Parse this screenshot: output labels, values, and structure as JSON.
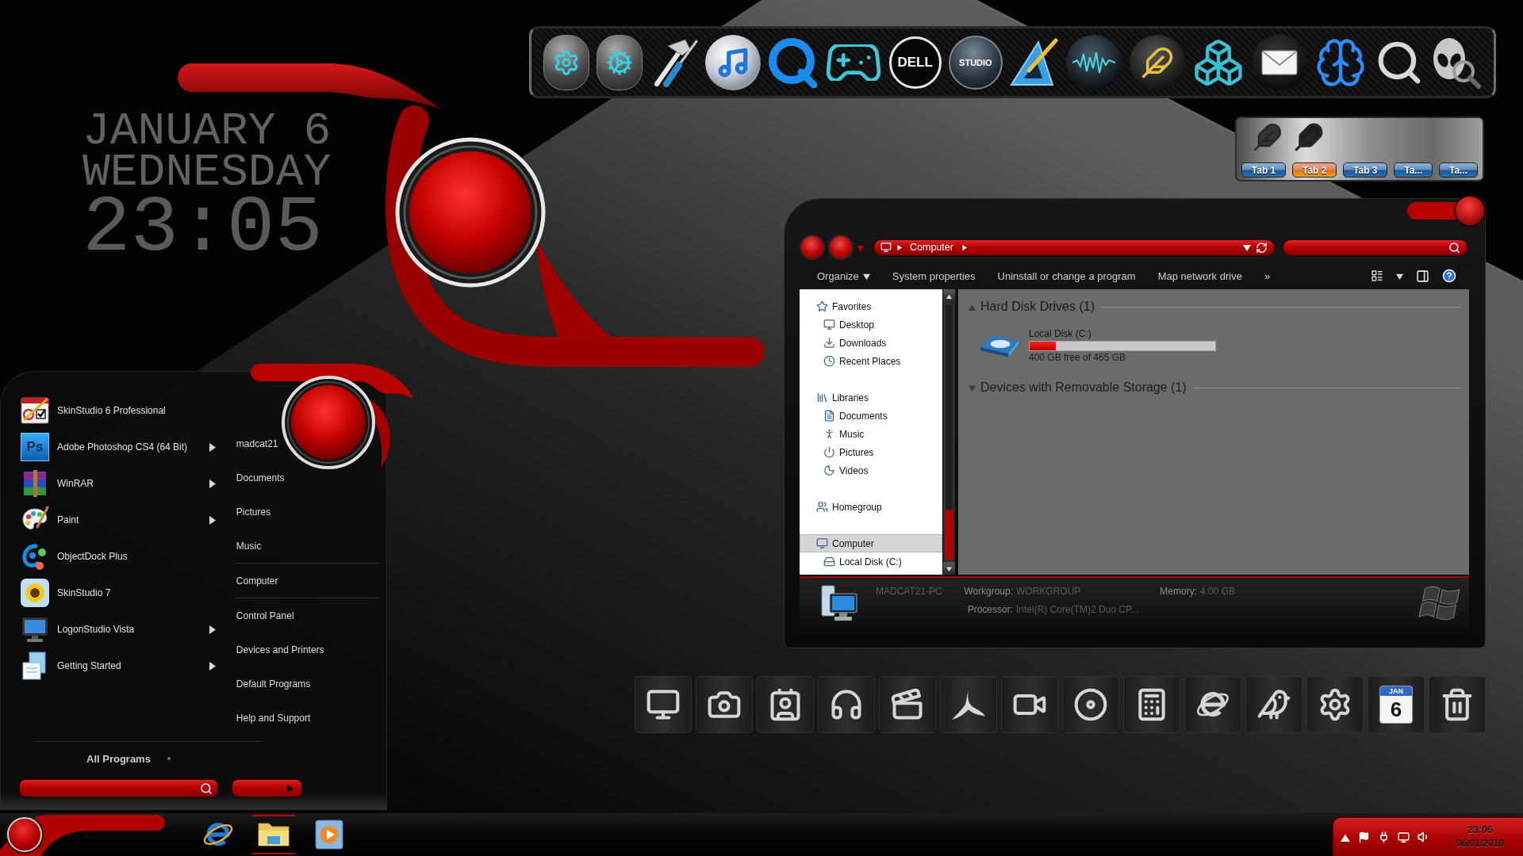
{
  "clock": {
    "date": "JANUARY 6",
    "weekday": "WEDNESDAY",
    "time": "23:05"
  },
  "top_dock": {
    "items": [
      {
        "kind": "capsule"
      },
      {
        "kind": "cog"
      },
      {
        "kind": "tools"
      },
      {
        "kind": "music"
      },
      {
        "kind": "ring"
      },
      {
        "kind": "gamepad"
      },
      {
        "kind": "logo",
        "label": "DELL"
      },
      {
        "kind": "sphere",
        "label": "STUDIO"
      },
      {
        "kind": "setsquare"
      },
      {
        "kind": "wave"
      },
      {
        "kind": "feather"
      },
      {
        "kind": "cubes"
      },
      {
        "kind": "mail"
      },
      {
        "kind": "brain"
      },
      {
        "kind": "magnifier"
      },
      {
        "kind": "alien"
      }
    ]
  },
  "tab_widget": {
    "tabs": [
      {
        "label": "Tab 1",
        "selected": false
      },
      {
        "label": "Tab 2",
        "selected": true
      },
      {
        "label": "Tab 3",
        "selected": false
      },
      {
        "label": "Ta...",
        "selected": false
      },
      {
        "label": "Ta...",
        "selected": false
      }
    ]
  },
  "explorer": {
    "address": {
      "crumbs": [
        "Computer"
      ]
    },
    "toolbar": {
      "items": [
        {
          "label": "Organize",
          "dropdown": true
        },
        {
          "label": "System properties",
          "dropdown": false
        },
        {
          "label": "Uninstall or change a program",
          "dropdown": false
        },
        {
          "label": "Map network drive",
          "dropdown": false
        }
      ],
      "overflow": "»"
    },
    "nav": {
      "groups": [
        {
          "label": "Favorites",
          "kind": "star",
          "selected": false,
          "children": [
            {
              "label": "Desktop",
              "kind": "monitor",
              "selected": false
            },
            {
              "label": "Downloads",
              "kind": "download",
              "selected": false
            },
            {
              "label": "Recent Places",
              "kind": "clock",
              "selected": false
            }
          ]
        },
        {
          "label": "Libraries",
          "kind": "library",
          "selected": false,
          "children": [
            {
              "label": "Documents",
              "kind": "document",
              "selected": false
            },
            {
              "label": "Music",
              "kind": "figure",
              "selected": false
            },
            {
              "label": "Pictures",
              "kind": "power",
              "selected": false
            },
            {
              "label": "Videos",
              "kind": "moon",
              "selected": false
            }
          ]
        },
        {
          "label": "Homegroup",
          "kind": "users",
          "selected": false
        },
        {
          "label": "Computer",
          "kind": "monitor",
          "selected": true,
          "children": [
            {
              "label": "Local Disk (C:)",
              "kind": "drive",
              "selected": false
            }
          ]
        }
      ]
    },
    "content": {
      "groups": [
        {
          "title": "Hard Disk Drives (1)",
          "expanded": true,
          "items": [
            {
              "name": "Local Disk (C:)",
              "level": 0.14,
              "free_space": "400 GB free of 465 GB"
            }
          ]
        },
        {
          "title": "Devices with Removable Storage (1)",
          "expanded": false
        }
      ]
    },
    "details": {
      "computer_name": "MADCAT21-PC",
      "workgroup_label": "Workgroup:",
      "workgroup": "WORKGROUP",
      "memory_label": "Memory:",
      "memory": "4.00 GB",
      "processor_label": "Processor:",
      "processor": "Intel(R) Core(TM)2 Duo CP..."
    }
  },
  "start_menu": {
    "programs": [
      {
        "name": "SkinStudio 6 Professional",
        "kind": "checklist",
        "submenu": false
      },
      {
        "name": "Adobe Photoshop CS4 (64 Bit)",
        "kind": "badge",
        "badge": "Ps",
        "submenu": true
      },
      {
        "name": "WinRAR",
        "kind": "books",
        "submenu": true
      },
      {
        "name": "Paint",
        "kind": "palette",
        "submenu": true
      },
      {
        "name": "ObjectDock Plus",
        "kind": "swirl",
        "submenu": false
      },
      {
        "name": "SkinStudio 7",
        "kind": "sunflower",
        "submenu": false
      },
      {
        "name": "LogonStudio Vista",
        "kind": "monitor",
        "submenu": true
      },
      {
        "name": "Getting Started",
        "kind": "documents",
        "submenu": true
      }
    ],
    "link_groups": [
      {
        "links": [
          "madcat21",
          "Documents",
          "Pictures",
          "Music"
        ]
      },
      {
        "links": [
          "Computer"
        ]
      },
      {
        "links": [
          "Control Panel",
          "Devices and Printers",
          "Default Programs",
          "Help and Support"
        ]
      }
    ],
    "all_programs": "All Programs"
  },
  "bottom_dock": {
    "items": [
      {
        "kind": "monitor"
      },
      {
        "kind": "camera"
      },
      {
        "kind": "contact"
      },
      {
        "kind": "headphones"
      },
      {
        "kind": "clapper"
      },
      {
        "kind": "blades"
      },
      {
        "kind": "video"
      },
      {
        "kind": "disc"
      },
      {
        "kind": "calculator"
      },
      {
        "kind": "browser"
      },
      {
        "kind": "bird"
      },
      {
        "kind": "gear"
      },
      {
        "kind": "calendar",
        "month": "JAN",
        "day": "6"
      },
      {
        "kind": "trash"
      }
    ]
  },
  "taskbar": {
    "pinned": [
      {
        "kind": "browser",
        "active": false
      },
      {
        "kind": "folder",
        "active": true
      },
      {
        "kind": "player",
        "active": false
      }
    ],
    "tray": {
      "time": "23:06",
      "date": "06/01/2010"
    }
  }
}
